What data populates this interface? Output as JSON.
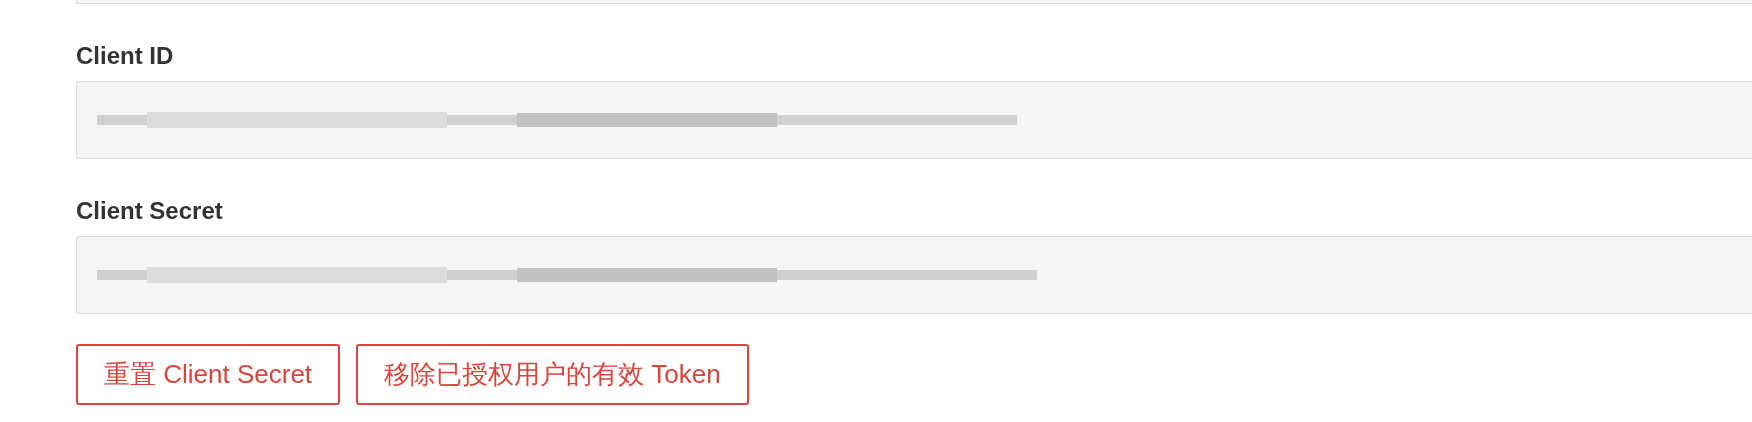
{
  "fields": [
    {
      "label": "Client ID"
    },
    {
      "label": "Client Secret"
    }
  ],
  "buttons": [
    {
      "label": "重置 Client Secret"
    },
    {
      "label": "移除已授权用户的有效 Token"
    }
  ]
}
